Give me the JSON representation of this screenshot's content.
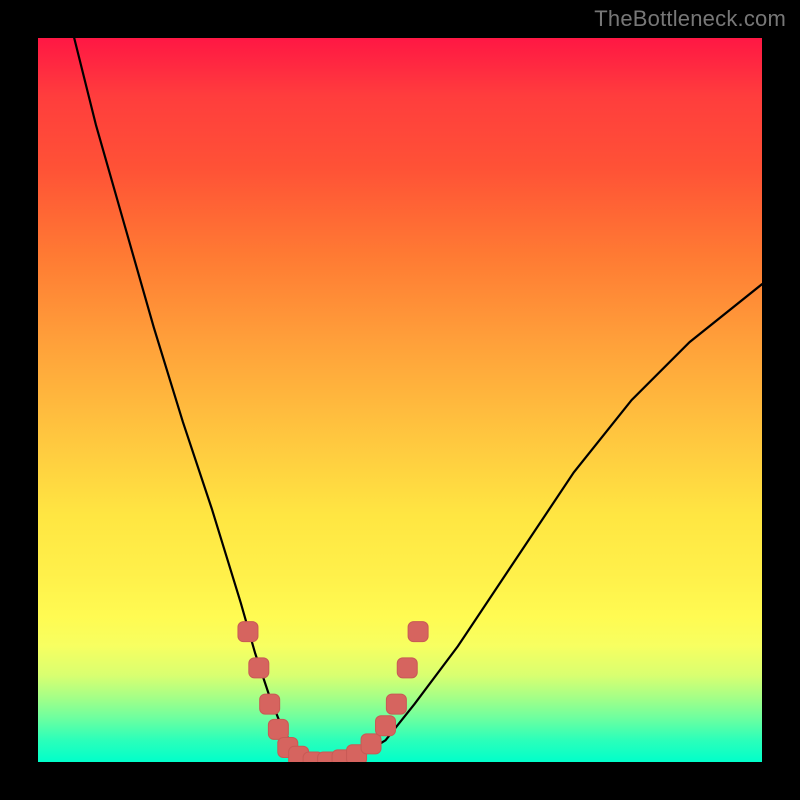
{
  "watermark": "TheBottleneck.com",
  "colors": {
    "background": "#000000",
    "curve_stroke": "#000000",
    "marker_fill": "#d6645f",
    "marker_stroke": "#c85a55"
  },
  "chart_data": {
    "type": "line",
    "title": "",
    "xlabel": "",
    "ylabel": "",
    "xlim": [
      0,
      100
    ],
    "ylim": [
      0,
      100
    ],
    "series": [
      {
        "name": "bottleneck-curve",
        "x": [
          5,
          8,
          12,
          16,
          20,
          24,
          28,
          30,
          32,
          34,
          36,
          38,
          40,
          44,
          48,
          52,
          58,
          66,
          74,
          82,
          90,
          100
        ],
        "y": [
          100,
          88,
          74,
          60,
          47,
          35,
          22,
          15,
          9,
          4,
          1.5,
          0,
          0,
          0.5,
          3,
          8,
          16,
          28,
          40,
          50,
          58,
          66
        ]
      }
    ],
    "markers": {
      "name": "optimal-range",
      "points": [
        {
          "x": 29,
          "y": 18
        },
        {
          "x": 30.5,
          "y": 13
        },
        {
          "x": 32,
          "y": 8
        },
        {
          "x": 33.2,
          "y": 4.5
        },
        {
          "x": 34.5,
          "y": 2
        },
        {
          "x": 36,
          "y": 0.8
        },
        {
          "x": 38,
          "y": 0
        },
        {
          "x": 40,
          "y": 0
        },
        {
          "x": 42,
          "y": 0.3
        },
        {
          "x": 44,
          "y": 1
        },
        {
          "x": 46,
          "y": 2.5
        },
        {
          "x": 48,
          "y": 5
        },
        {
          "x": 49.5,
          "y": 8
        },
        {
          "x": 51,
          "y": 13
        },
        {
          "x": 52.5,
          "y": 18
        }
      ]
    }
  }
}
